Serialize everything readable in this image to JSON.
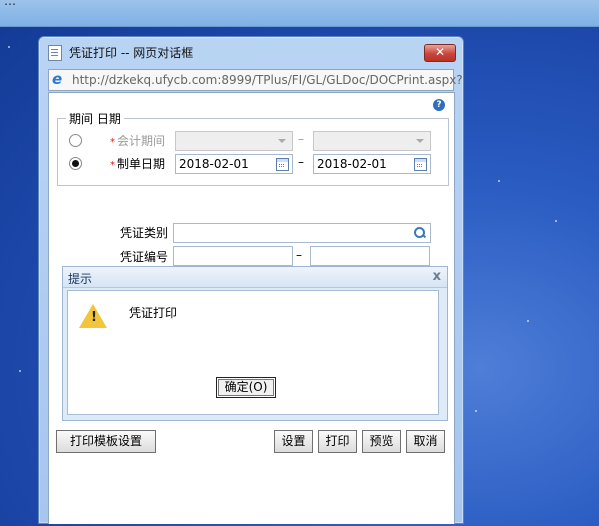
{
  "top_strip_text": "…",
  "window": {
    "title": "凭证打印 -- 网页对话框",
    "close": "✕",
    "url": "http://dzkekq.ufycb.com:8999/TPlus/FI/GL/GLDoc/DOCPrint.aspx?"
  },
  "form": {
    "help": "?",
    "period_legend": "期间 日期",
    "accounting_period_label": "会计期间",
    "doc_date_label": "制单日期",
    "required_star": "*",
    "date_from": "2018-02-01",
    "date_to": "2018-02-01",
    "dash": "–",
    "voucher_type_label": "凭证类别",
    "voucher_number_label": "凭证编号"
  },
  "message": {
    "title": "提示",
    "close": "x",
    "warn_mark": "!",
    "text": "凭证打印",
    "ok_label": "确定(O)"
  },
  "buttons": {
    "template_settings": "打印模板设置",
    "settings": "设置",
    "print": "打印",
    "preview": "预览",
    "cancel": "取消"
  }
}
